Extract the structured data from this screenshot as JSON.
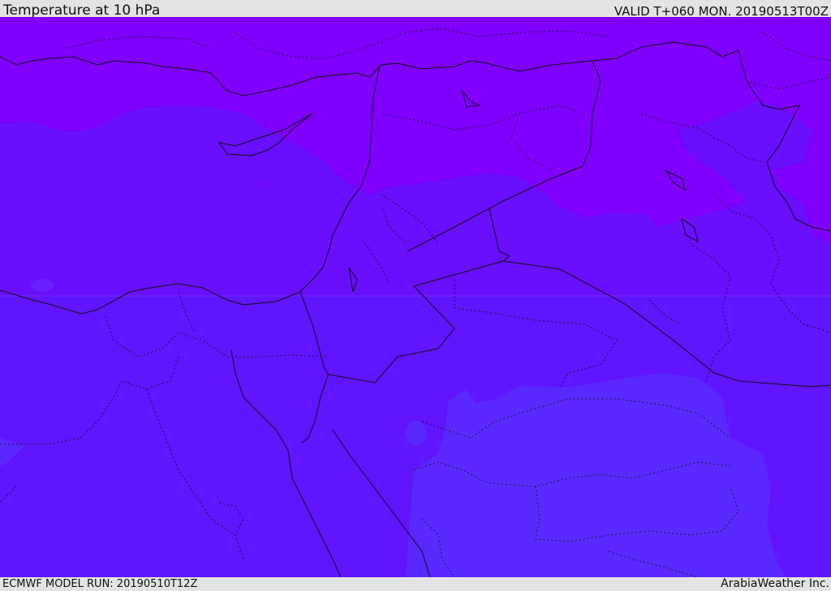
{
  "header": {
    "title": "Temperature at 10 hPa",
    "valid_time": "VALID T+060 MON. 20190513T00Z"
  },
  "footer": {
    "model_run": "ECMWF MODEL RUN: 20190510T12Z",
    "credit": "ArabiaWeather Inc."
  },
  "map": {
    "field": "temperature",
    "level": "10 hPa",
    "colors": {
      "coldest": "#7f00ff",
      "cold": "#6b10ff",
      "mid": "#6014ff",
      "warmer": "#5a28ff",
      "border": "#111111"
    }
  }
}
